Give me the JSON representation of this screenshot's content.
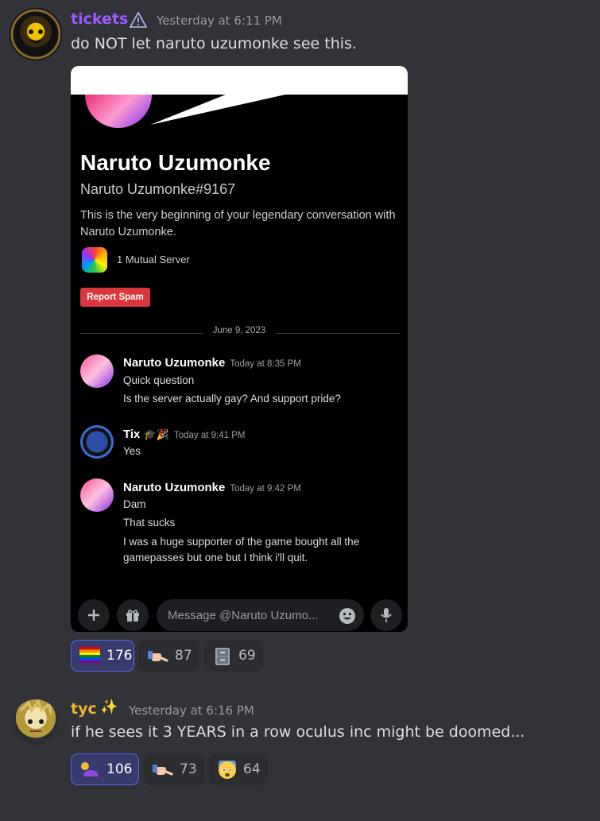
{
  "messages": [
    {
      "author": "tickets",
      "timestamp": "Yesterday at 6:11 PM",
      "content": "do NOT let naruto uzumonke see this.",
      "author_color": "#9b59ff",
      "badge_icon": "warning-triangle-icon",
      "reactions": [
        {
          "emoji": "rainbow-flag-icon",
          "count": "176",
          "active": true
        },
        {
          "emoji": "pointing-hand-icon",
          "count": "87",
          "active": false
        },
        {
          "emoji": "file-cabinet-icon",
          "count": "69",
          "active": false
        }
      ]
    },
    {
      "author": "tyc",
      "author_suffix": "✨",
      "timestamp": "Yesterday at 6:16 PM",
      "content": "if he sees it 3 YEARS in a row oculus inc might be doomed...",
      "author_color": "#f0b232",
      "reactions": [
        {
          "emoji": "person-lying-icon",
          "count": "106",
          "active": true
        },
        {
          "emoji": "pointing-hand-icon",
          "count": "73",
          "active": false
        },
        {
          "emoji": "fearful-face-icon",
          "count": "64",
          "active": false
        }
      ]
    }
  ],
  "embed": {
    "dm_name": "Naruto Uzumonke",
    "dm_tag": "Naruto Uzumonke#9167",
    "intro": "This is the very beginning of your legendary conversation with Naruto Uzumonke.",
    "mutual": "1 Mutual Server",
    "report_label": "Report Spam",
    "date_divider": "June 9, 2023",
    "chat": [
      {
        "author": "Naruto Uzumonke",
        "timestamp": "Today at 8:35 PM",
        "lines": [
          "Quick question",
          "Is the server actually gay? And support pride?"
        ]
      },
      {
        "author": "Tix",
        "author_suffix": "🎓🎉",
        "timestamp": "Today at 9:41 PM",
        "lines": [
          "Yes"
        ]
      },
      {
        "author": "Naruto Uzumonke",
        "timestamp": "Today at 9:42 PM",
        "lines": [
          "Dam",
          "That sucks",
          "I was a huge supporter of the game bought all the",
          "gamepasses but one but I think i'll quit."
        ]
      }
    ],
    "composer_placeholder": "Message @Naruto Uzumo..."
  }
}
